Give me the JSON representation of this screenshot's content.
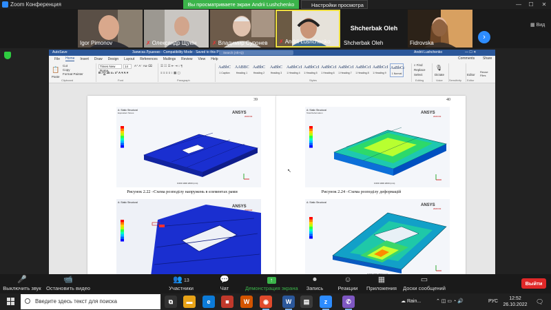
{
  "zoom": {
    "window_title": "Zoom Конференция",
    "share_banner": "Вы просматриваете экран Andrii Lushchenko",
    "view_options": "Настройки просмотра",
    "view_button": "Вид"
  },
  "participants": [
    {
      "name": "Igor Pimonov",
      "muted": false
    },
    {
      "name": "Олександр Щукін",
      "muted": true
    },
    {
      "name": "Владимир Супонев",
      "muted": true
    },
    {
      "name": "Andrii Lushchenko",
      "muted": true
    },
    {
      "name": "Shcherbak Oleh",
      "muted": false,
      "big_label": "Shcherbak Oleh"
    },
    {
      "name": "Fidrovska",
      "muted": false
    }
  ],
  "word": {
    "autosave": "AutoSave",
    "doc_title": "Записка Лушенко - Compatibility Mode - Saved to this PC",
    "search_placeholder": "Search (Alt+Q)",
    "user": "Andrii Lushchenko",
    "tabs": [
      "File",
      "Home",
      "Insert",
      "Draw",
      "Design",
      "Layout",
      "References",
      "Mailings",
      "Review",
      "View",
      "Help"
    ],
    "active_tab": "Home",
    "comments_btn": "Comments",
    "share_btn": "Share",
    "font_name": "Times New Roma",
    "font_size": "14",
    "clipboard_label": "Clipboard",
    "font_label": "Font",
    "paragraph_label": "Paragraph",
    "styles_label": "Styles",
    "editing_label": "Editing",
    "voice_label": "Voice",
    "sensitivity_label": "Sensitivity",
    "editor_label": "Editor",
    "paste_label": "Paste",
    "cut_label": "Cut",
    "copy_label": "Copy",
    "format_painter_label": "Format Painter",
    "find_label": "Find",
    "replace_label": "Replace",
    "select_label": "Select",
    "dictate_label": "Dictate",
    "editor_btn": "Editor",
    "reuse_files": "Reuse Files",
    "styles": [
      {
        "sample": "AaBbC",
        "name": "1 Caption"
      },
      {
        "sample": "AABBC",
        "name": "Heading 1"
      },
      {
        "sample": "AaBbC",
        "name": "Heading 2"
      },
      {
        "sample": "AaBbC",
        "name": "Heading 3"
      },
      {
        "sample": "AaBbCcI",
        "name": "1 Heading 4"
      },
      {
        "sample": "AaBbCcI",
        "name": "1 Heading 5"
      },
      {
        "sample": "AaBbCcI",
        "name": "1 Heading 6"
      },
      {
        "sample": "AaBbCcI",
        "name": "1 Heading 7"
      },
      {
        "sample": "AaBbCcI",
        "name": "1 Heading 8"
      },
      {
        "sample": "AaBbCcI",
        "name": "1 Heading 9"
      },
      {
        "sample": "AaBbCc",
        "name": "1 Normal"
      }
    ],
    "page_left_number": "39",
    "page_right_number": "40",
    "caption_left": "Рисунок 2.22 –Схема розподілу напружень в елементах рами",
    "caption_right": "Рисунок 2.24 –Схема розподілу деформацій",
    "ansys_brand": "ANSYS",
    "ansys_version": "2020 R2"
  },
  "toolbar": {
    "mute": "Выключить звук",
    "video": "Остановить видео",
    "participants": "Участники",
    "participants_count": "13",
    "chat": "Чат",
    "share": "Демонстрация экрана",
    "record": "Запись",
    "reactions": "Реакции",
    "apps": "Приложения",
    "rooms": "Доски сообщений",
    "end": "Выйти"
  },
  "taskbar": {
    "search_placeholder": "Введите здесь текст для поиска",
    "weather": "Rain...",
    "lang": "РУС",
    "time": "12:52",
    "date": "26.10.2022"
  },
  "colors": {
    "zoom_green": "#3bb44a",
    "zoom_blue": "#2d8cff",
    "word_blue": "#2b579a",
    "end_red": "#e02828",
    "mesh_blue": "#1a2fd0"
  }
}
